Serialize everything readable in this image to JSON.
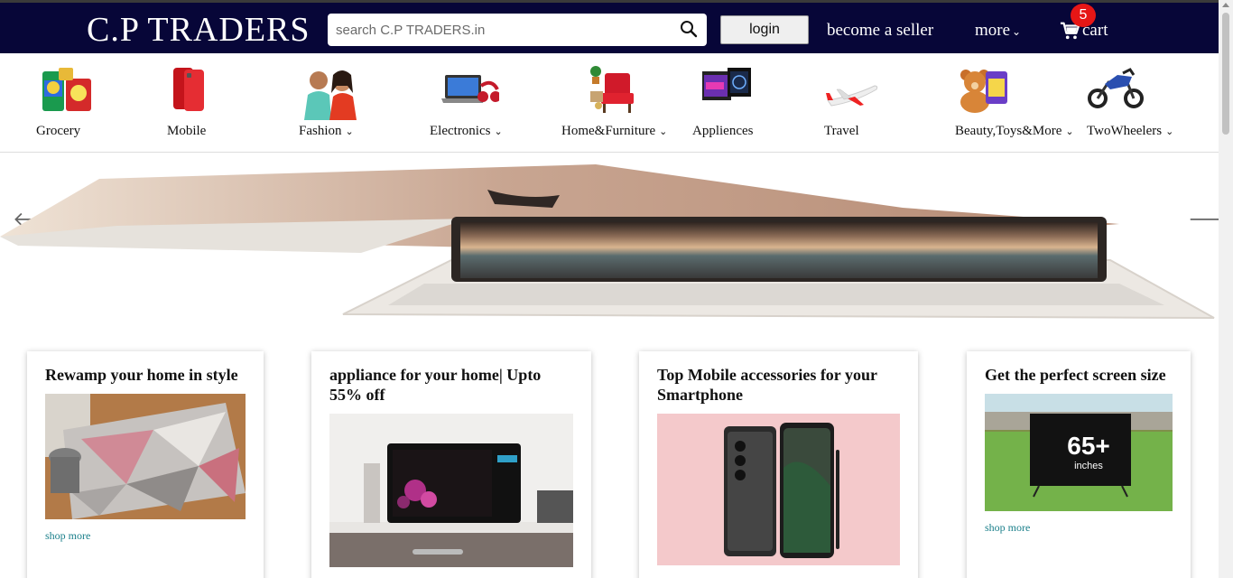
{
  "header": {
    "brand": "C.P TRADERS",
    "search_placeholder": "search C.P TRADERS.in",
    "login_label": "login",
    "become_seller": "become a seller",
    "more": "more",
    "cart_label": "cart",
    "cart_count": "5",
    "bg_color": "#070638"
  },
  "categories": [
    {
      "label": "Grocery",
      "icon": "grocery-icon"
    },
    {
      "label": "Mobile",
      "icon": "mobile-icon"
    },
    {
      "label": "Fashion",
      "icon": "fashion-icon",
      "dropdown": true
    },
    {
      "label": "Electronics",
      "icon": "electronics-icon",
      "dropdown": true
    },
    {
      "label": "Home&Furniture",
      "icon": "furniture-icon",
      "dropdown": true
    },
    {
      "label": "Appliences",
      "icon": "appliances-icon"
    },
    {
      "label": "Travel",
      "icon": "airplane-icon"
    },
    {
      "label": "Beauty,Toys&More",
      "icon": "toys-icon",
      "dropdown": true
    },
    {
      "label": "TwoWheelers",
      "icon": "motorbike-icon",
      "dropdown": true
    }
  ],
  "cards": [
    {
      "title": "Rewamp your home in style",
      "link": "shop more"
    },
    {
      "title": "appliance for your home| Upto 55% off"
    },
    {
      "title": "Top Mobile accessories for your Smartphone"
    },
    {
      "title": "Get the perfect screen size",
      "link": "shop more"
    }
  ],
  "tv_badge": {
    "size": "65+",
    "unit": "inches"
  }
}
